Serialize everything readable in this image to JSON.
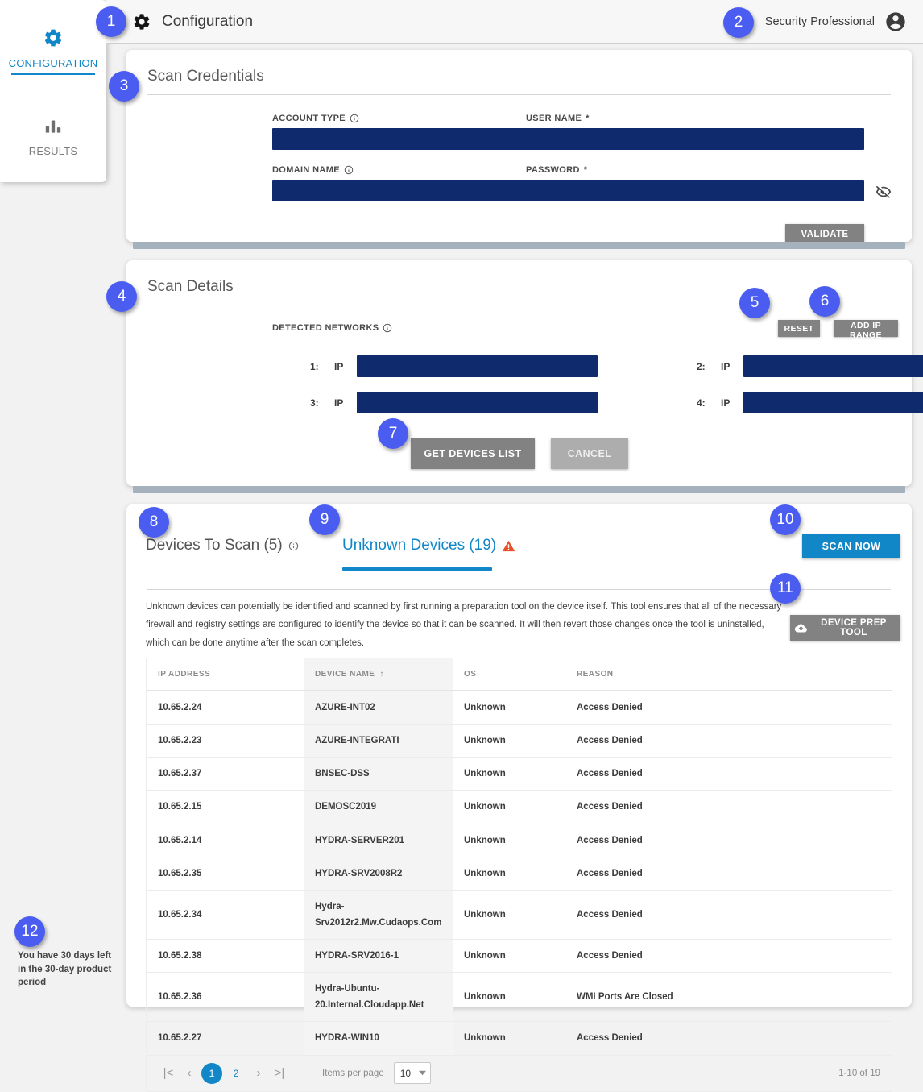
{
  "sidebar": {
    "items": [
      {
        "label": "CONFIGURATION",
        "icon": "gear-icon",
        "active": true
      },
      {
        "label": "RESULTS",
        "icon": "bar-chart-icon",
        "active": false
      }
    ],
    "trial_notice": "You have 30 days left in the 30-day product period"
  },
  "topbar": {
    "icon": "gear-icon",
    "title": "Configuration",
    "user_name": "Security Professional",
    "avatar_icon": "account-circle-icon"
  },
  "scan_credentials": {
    "title": "Scan Credentials",
    "fields": {
      "account_type": {
        "label": "ACCOUNT TYPE",
        "value": "",
        "info": true
      },
      "domain_name": {
        "label": "DOMAIN NAME",
        "value": "",
        "info": true
      },
      "user_name": {
        "label": "USER NAME",
        "value": "",
        "required": "*"
      },
      "password": {
        "label": "PASSWORD",
        "value": "",
        "required": "*",
        "toggle_icon": "visibility-off-icon"
      }
    },
    "validate_label": "VALIDATE"
  },
  "scan_details": {
    "title": "Scan Details",
    "networks_label": "DETECTED NETWORKS",
    "reset_label": "RESET",
    "add_ip_range_label": "ADD IP RANGE",
    "rows": [
      {
        "index": "1:",
        "type": "IP",
        "value": ""
      },
      {
        "index": "2:",
        "type": "IP",
        "value": ""
      },
      {
        "index": "3:",
        "type": "IP",
        "value": ""
      },
      {
        "index": "4:",
        "type": "IP",
        "value": ""
      }
    ],
    "get_devices_label": "GET DEVICES LIST",
    "cancel_label": "CANCEL"
  },
  "devices_panel": {
    "tabs": [
      {
        "label": "Devices To Scan (5)",
        "active": false,
        "icon": "info-icon"
      },
      {
        "label": "Unknown Devices (19)",
        "active": true,
        "icon": "warning-triangle-icon"
      }
    ],
    "scan_now_label": "SCAN NOW",
    "device_prep_label": "DEVICE PREP TOOL",
    "device_prep_icon": "cloud-download-icon",
    "description": "Unknown devices can potentially be identified and scanned by first running a preparation tool on the device itself. This tool ensures that all of the necessary firewall and registry settings are configured to identify the device so that it can be scanned. It will then revert those changes once the tool is uninstalled, which can be done anytime after the scan completes.",
    "table": {
      "columns": [
        "IP ADDRESS",
        "DEVICE NAME",
        "OS",
        "REASON"
      ],
      "sorted_column": "DEVICE NAME",
      "sort_direction": "↑",
      "rows": [
        {
          "ip": "10.65.2.24",
          "device": "AZURE-INT02",
          "os": "Unknown",
          "reason": "Access Denied"
        },
        {
          "ip": "10.65.2.23",
          "device": "AZURE-INTEGRATI",
          "os": "Unknown",
          "reason": "Access Denied"
        },
        {
          "ip": "10.65.2.37",
          "device": "BNSEC-DSS",
          "os": "Unknown",
          "reason": "Access Denied"
        },
        {
          "ip": "10.65.2.15",
          "device": "DEMOSC2019",
          "os": "Unknown",
          "reason": "Access Denied"
        },
        {
          "ip": "10.65.2.14",
          "device": "HYDRA-SERVER201",
          "os": "Unknown",
          "reason": "Access Denied"
        },
        {
          "ip": "10.65.2.35",
          "device": "HYDRA-SRV2008R2",
          "os": "Unknown",
          "reason": "Access Denied"
        },
        {
          "ip": "10.65.2.34",
          "device": "Hydra-Srv2012r2.Mw.Cudaops.Com",
          "os": "Unknown",
          "reason": "Access Denied"
        },
        {
          "ip": "10.65.2.38",
          "device": "HYDRA-SRV2016-1",
          "os": "Unknown",
          "reason": "Access Denied"
        },
        {
          "ip": "10.65.2.36",
          "device": "Hydra-Ubuntu-20.Internal.Cloudapp.Net",
          "os": "Unknown",
          "reason": "WMI Ports Are Closed"
        },
        {
          "ip": "10.65.2.27",
          "device": "HYDRA-WIN10",
          "os": "Unknown",
          "reason": "Access Denied"
        }
      ]
    },
    "paginator": {
      "first_icon": "|<",
      "prev_icon": "‹",
      "next_icon": "›",
      "last_icon": ">|",
      "pages": [
        "1",
        "2"
      ],
      "current_page": "1",
      "items_per_page_label": "Items per page",
      "items_per_page_value": "10",
      "range_label": "1-10 of 19"
    }
  },
  "annotations": [
    {
      "n": "1"
    },
    {
      "n": "2"
    },
    {
      "n": "3"
    },
    {
      "n": "4"
    },
    {
      "n": "5"
    },
    {
      "n": "6"
    },
    {
      "n": "7"
    },
    {
      "n": "8"
    },
    {
      "n": "9"
    },
    {
      "n": "10"
    },
    {
      "n": "11"
    },
    {
      "n": "12"
    }
  ],
  "colors": {
    "accent_blue": "#1187c9",
    "redacted_navy": "#102a6e",
    "badge_blue": "#4a5df0",
    "warning_orange": "#e8502a",
    "grey_button": "#828282"
  }
}
